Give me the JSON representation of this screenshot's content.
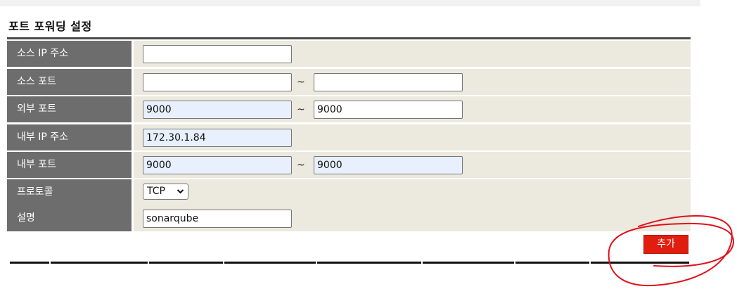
{
  "page": {
    "title": "포트 포워딩 설정"
  },
  "form": {
    "source_ip": {
      "label": "소스 IP 주소",
      "value": ""
    },
    "source_port": {
      "label": "소스 포트",
      "from": "",
      "to": "",
      "separator": "~"
    },
    "external_port": {
      "label": "외부 포트",
      "from": "9000",
      "to": "9000",
      "separator": "~"
    },
    "internal_ip": {
      "label": "내부 IP 주소",
      "value": "172.30.1.84"
    },
    "internal_port": {
      "label": "내부 포트",
      "from": "9000",
      "to": "9000",
      "separator": "~"
    },
    "protocol": {
      "label": "프로토콜",
      "selected": "TCP"
    },
    "description": {
      "label": "설명",
      "value": "sonarqube"
    }
  },
  "actions": {
    "add_label": "추가"
  },
  "colors": {
    "label_bg": "#6d6d6d",
    "row_bg": "#ece9df",
    "add_button": "#e01d0e",
    "annotation": "#e0101a"
  }
}
